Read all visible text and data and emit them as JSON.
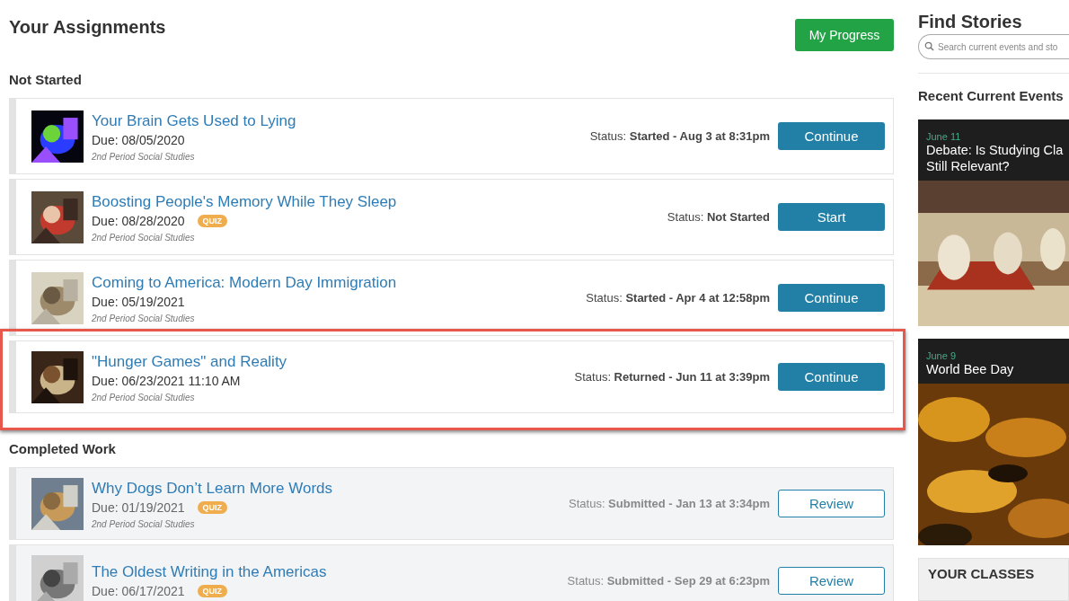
{
  "header": {
    "title": "Your Assignments",
    "progress_button": "My Progress"
  },
  "sections": [
    {
      "heading": "Not Started",
      "completed": false,
      "assignments": [
        {
          "title": "Your Brain Gets Used to Lying",
          "due": "Due: 08/05/2020",
          "class": "2nd Period Social Studies",
          "status": "Status: **Started - Aug 3 at 8:31pm**",
          "action": {
            "label": "Continue",
            "kind": "primary"
          },
          "highlighted": false
        },
        {
          "title": "Boosting People's Memory While They Sleep",
          "due": "Due: 08/28/2020",
          "quiz": "QUIZ",
          "class": "2nd Period Social Studies",
          "status": "Status: **Not Started**",
          "action": {
            "label": "Start",
            "kind": "primary"
          },
          "highlighted": false
        },
        {
          "title": "Coming to America: Modern Day Immigration",
          "due": "Due: 05/19/2021",
          "class": "2nd Period Social Studies",
          "status": "Status: **Started - Apr 4 at 12:58pm**",
          "action": {
            "label": "Continue",
            "kind": "primary"
          },
          "highlighted": false
        },
        {
          "title": "\"Hunger Games\" and Reality",
          "due": "Due: 06/23/2021 11:10 AM",
          "class": "2nd Period Social Studies",
          "status": "Status: **Returned - Jun 11 at 3:39pm**",
          "action": {
            "label": "Continue",
            "kind": "primary"
          },
          "highlighted": true
        }
      ]
    },
    {
      "heading": "Completed Work",
      "completed": true,
      "assignments": [
        {
          "title": "Why Dogs Don’t Learn More Words",
          "due": "Due: 01/19/2021",
          "quiz": "QUIZ",
          "class": "2nd Period Social Studies",
          "status": "Status: **Submitted - Jan 13 at 3:34pm**",
          "action": {
            "label": "Review",
            "kind": "outline"
          },
          "highlighted": false
        },
        {
          "title": "The Oldest Writing in the Americas",
          "due": "Due: 06/17/2021",
          "quiz": "QUIZ",
          "status": "Status: **Submitted - Sep 29 at 6:23pm**",
          "action": {
            "label": "Review",
            "kind": "outline"
          },
          "highlighted": false
        }
      ]
    }
  ],
  "sidebar": {
    "title": "Find Stories",
    "search": {
      "placeholder": "Search current events and sto"
    },
    "recent_heading": "Recent Current Events",
    "stories": [
      {
        "date": "June 11",
        "title_lines": [
          "Debate: Is Studying Cla",
          "Still Relevant?"
        ]
      },
      {
        "date": "June 9",
        "title_lines": [
          "World Bee Day"
        ]
      }
    ],
    "classes_heading": "YOUR CLASSES"
  }
}
